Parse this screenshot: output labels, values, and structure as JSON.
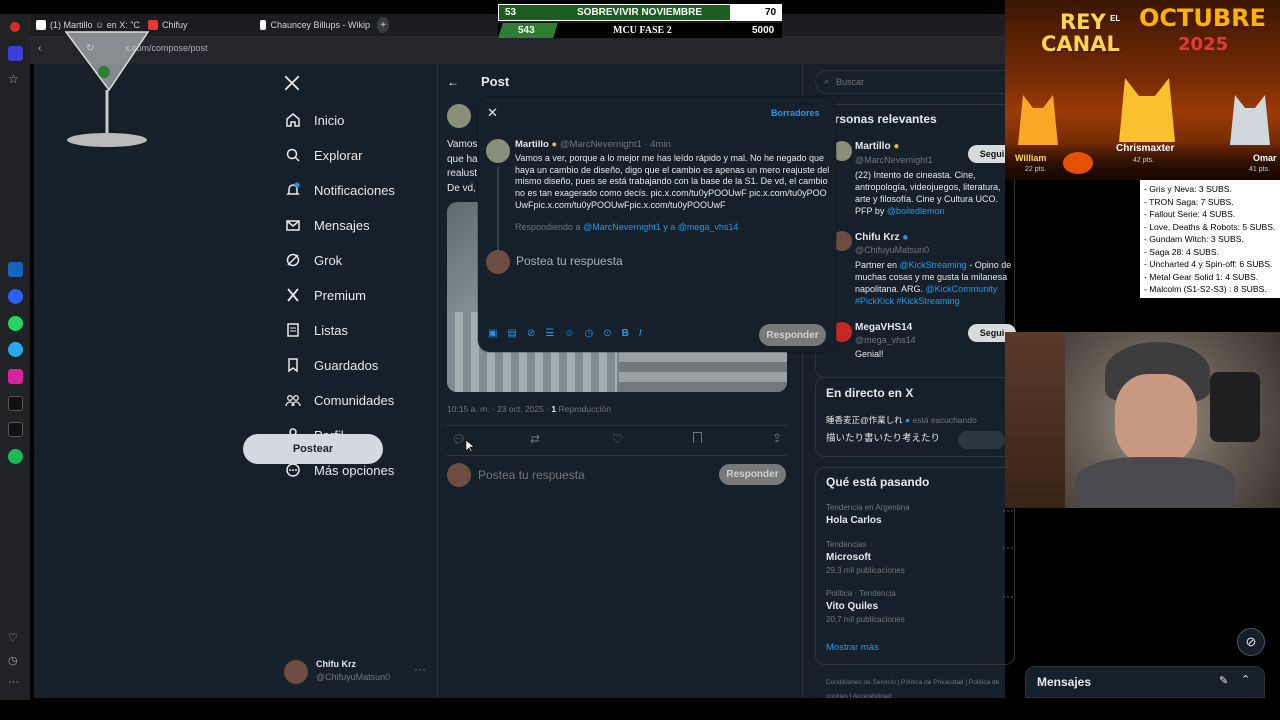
{
  "browser": {
    "tabs": [
      {
        "label": "(1) Martillo ☺ en X: \"C",
        "color": "#ffffff"
      },
      {
        "label": "Chifuy",
        "color": "#e53935"
      },
      {
        "label": "Chauncey Billups - Wikip",
        "color": "#ffffff"
      }
    ],
    "new_tab": "+",
    "url": "x.com/compose/post"
  },
  "counter": {
    "row1": {
      "left": "53",
      "title": "SOBREVIVIR NOVIEMBRE",
      "right": "70"
    },
    "row2": {
      "left": "543",
      "title": "MCU FASE 2",
      "right": "5000"
    }
  },
  "rey_panel": {
    "title_left": "REY",
    "title_mid": "EL",
    "title_left2": "CANAL",
    "title_right": "OCTUBRE",
    "year": "2025",
    "players": [
      {
        "name": "William",
        "pts": "22 pts."
      },
      {
        "name": "Chrismaxter",
        "pts": "42 pts."
      },
      {
        "name": "Omar",
        "pts": "41 pts."
      }
    ]
  },
  "subs_list": [
    "- Gris y Neva: 3 SUBS.",
    "- TRON Saga: 7 SUBS.",
    "- Fallout Serie: 4 SUBS.",
    "- Love, Deaths & Robots: 5 SUBS.",
    "- Gundam Witch: 3 SUBS.",
    "- Saga 28: 4 SUBS.",
    "- Uncharted 4 y Spin-off: 6 SUBS.",
    "- Metal Gear Solid 1: 4 SUBS.",
    "- Malcolm (S1-S2-S3) : 8 SUBS."
  ],
  "nav": {
    "items": [
      {
        "label": "Inicio",
        "icon": "home-icon"
      },
      {
        "label": "Explorar",
        "icon": "search-icon"
      },
      {
        "label": "Notificaciones",
        "icon": "bell-icon"
      },
      {
        "label": "Mensajes",
        "icon": "mail-icon"
      },
      {
        "label": "Grok",
        "icon": "grok-icon"
      },
      {
        "label": "Premium",
        "icon": "x-logo-icon"
      },
      {
        "label": "Listas",
        "icon": "list-icon"
      },
      {
        "label": "Guardados",
        "icon": "bookmark-icon"
      },
      {
        "label": "Comunidades",
        "icon": "communities-icon"
      },
      {
        "label": "Perfil",
        "icon": "user-icon"
      },
      {
        "label": "Más opciones",
        "icon": "more-icon"
      }
    ],
    "post_button": "Postear"
  },
  "account": {
    "name": "Chifu Krz",
    "handle": "@ChifuyuMatsun0",
    "menu": "···"
  },
  "post_column": {
    "header": "Post",
    "text_fragments": [
      "Vamos",
      "que ha",
      "realust",
      "De vd,"
    ],
    "meta_time": "10:15 a. m. · 23 oct. 2025 · ",
    "meta_views": "1",
    "meta_views_label": " Reproducción",
    "reply_placeholder": "Postea tu respuesta",
    "reply_button": "Responder"
  },
  "modal": {
    "drafts": "Borradores",
    "author": "Martillo",
    "handle_time": "@MarcNevernight1 · 4min",
    "text": "Vamos a ver, porque a lo mejor me has leído rápido y mal. No he negado que haya un cambio de diseño, digo que el cambio es apenas un mero reajuste del mismo diseño, pues se está trabajando con la base de la S1. De vd, el cambio no es tan exagerado como decís. pic.x.com/tu0yPOOUwF pic.x.com/tu0yPOOUwFpic.x.com/tu0yPOOUwFpic.x.com/tu0yPOOUwF",
    "replying_prefix": "Respondiendo a ",
    "replying_to": "@MarcNevernight1 y a @mega_vhs14",
    "placeholder": "Postea tu respuesta",
    "reply_button": "Responder"
  },
  "right_column": {
    "search_placeholder": "Buscar",
    "relevant_title": "ersonas relevantes",
    "people": [
      {
        "name": "Martillo",
        "handle": "@MarcNevernight1",
        "bio": "(22) Intento de cineasta. Cine, antropología, videojuegos, literatura, arte y filosofía. Cine y Cultura UCO. PFP by ",
        "bio_link": "@boiledlemon",
        "follow": "Segui"
      },
      {
        "name": "Chifu Krz",
        "handle": "@ChifuyuMatsun0",
        "bio": "Partner en ",
        "bio_link": "@KickStreaming",
        "bio2": " - Opino de muchas cosas y me gusta la milanesa napolitana. ARG. ",
        "bio_link2": "@KickCommunity #PickKick #KickStreaming",
        "follow": ""
      },
      {
        "name": "MegaVHS14",
        "handle": "@mega_vhs14",
        "bio": "Genial!",
        "bio_link": "",
        "follow": "Segui"
      }
    ],
    "live_title": "En directo en X",
    "live_user": "睡香麦正@作業しれ",
    "live_status": "está escuchando",
    "live_text": "描いたり書いたり考えたり",
    "trends_title": "Qué está pasando",
    "trends": [
      {
        "context": "Tendencia en Argentina",
        "name": "Hola Carlos",
        "count": ""
      },
      {
        "context": "Tendencias",
        "name": "Microsoft",
        "count": "29,3 mil publicaciones"
      },
      {
        "context": "Política · Tendencia",
        "name": "Vito Quiles",
        "count": "20,7 mil publicaciones"
      }
    ],
    "show_more": "Mostrar más",
    "footer_links": [
      "Condiciones de Servicio",
      "Política de Privacidad",
      "Política de cookies",
      "Accesibilidad"
    ]
  },
  "messages_bar": {
    "label": "Mensajes"
  }
}
